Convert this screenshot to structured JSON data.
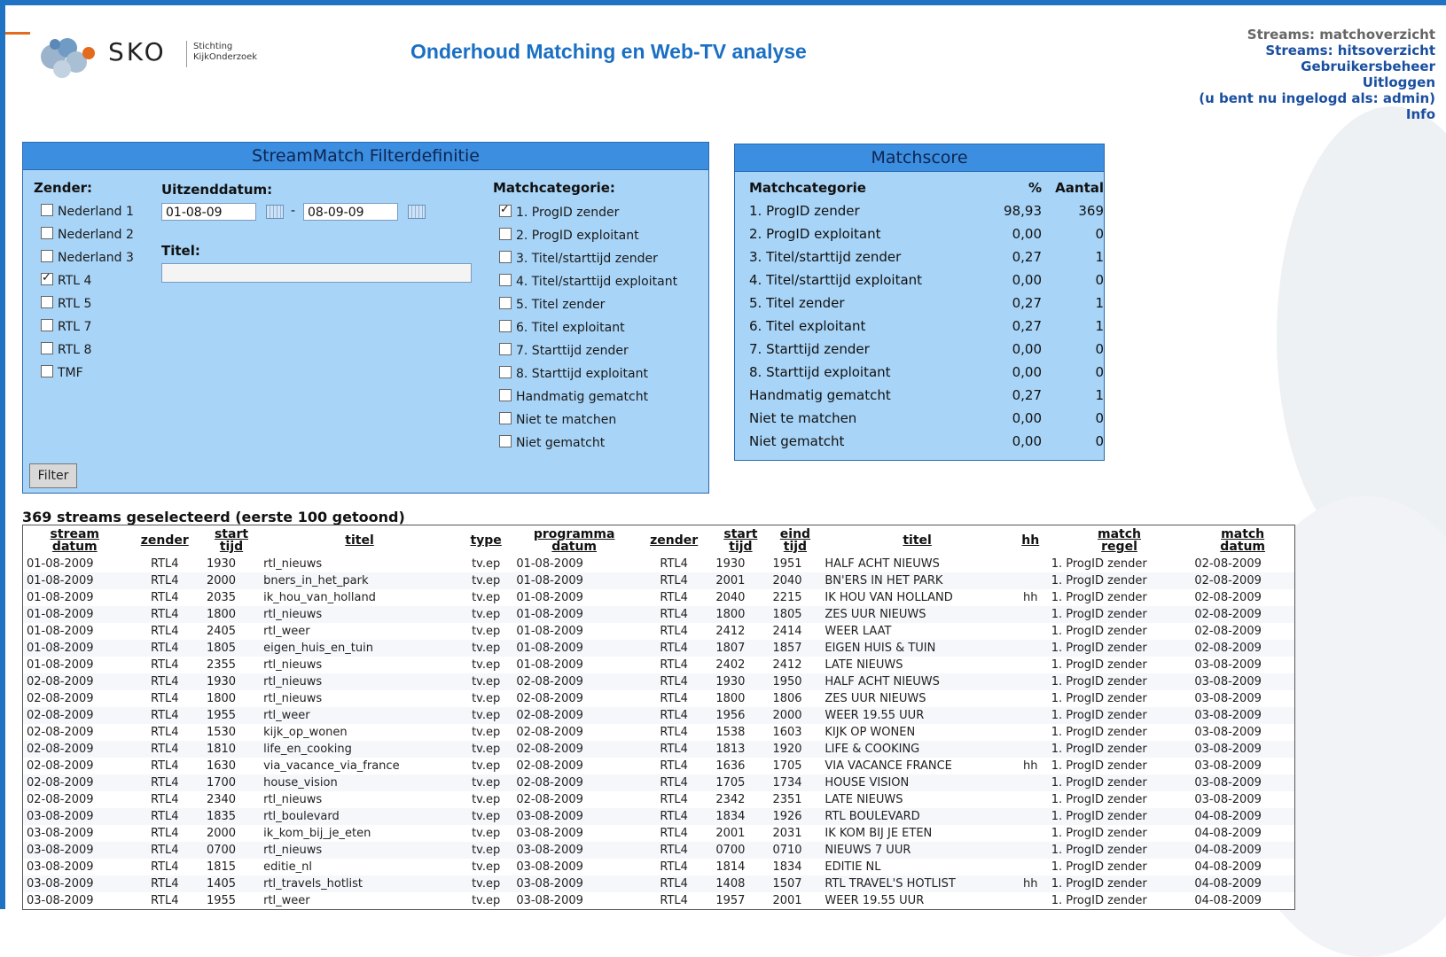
{
  "header": {
    "logo_text": "SKO",
    "logo_sub1": "Stichting",
    "logo_sub2": "KijkOnderzoek",
    "title": "Onderhoud Matching en Web-TV analyse"
  },
  "nav": {
    "matchoverzicht": "Streams: matchoverzicht",
    "hitsoverzicht": "Streams: hitsoverzicht",
    "gebruikersbeheer": "Gebruikersbeheer",
    "uitloggen": "Uitloggen",
    "ingelogd": "(u bent nu ingelogd als: admin)",
    "info": "Info"
  },
  "filter": {
    "title": "StreamMatch Filterdefinitie",
    "zender_label": "Zender:",
    "zenders": [
      {
        "label": "Nederland 1",
        "checked": false
      },
      {
        "label": "Nederland 2",
        "checked": false
      },
      {
        "label": "Nederland 3",
        "checked": false
      },
      {
        "label": "RTL 4",
        "checked": true
      },
      {
        "label": "RTL 5",
        "checked": false
      },
      {
        "label": "RTL 7",
        "checked": false
      },
      {
        "label": "RTL 8",
        "checked": false
      },
      {
        "label": "TMF",
        "checked": false
      }
    ],
    "uitzenddatum_label": "Uitzenddatum:",
    "date_from": "01-08-09",
    "date_sep": "-",
    "date_to": "08-09-09",
    "titel_label": "Titel:",
    "titel_value": "",
    "matchcat_label": "Matchcategorie:",
    "categories": [
      {
        "label": "1. ProgID zender",
        "checked": true
      },
      {
        "label": "2. ProgID exploitant",
        "checked": false
      },
      {
        "label": "3. Titel/starttijd zender",
        "checked": false
      },
      {
        "label": "4. Titel/starttijd exploitant",
        "checked": false
      },
      {
        "label": "5. Titel zender",
        "checked": false
      },
      {
        "label": "6. Titel exploitant",
        "checked": false
      },
      {
        "label": "7. Starttijd zender",
        "checked": false
      },
      {
        "label": "8. Starttijd exploitant",
        "checked": false
      },
      {
        "label": "Handmatig gematcht",
        "checked": false
      },
      {
        "label": "Niet te matchen",
        "checked": false
      },
      {
        "label": "Niet gematcht",
        "checked": false
      }
    ],
    "button": "Filter"
  },
  "score": {
    "title": "Matchscore",
    "headers": [
      "Matchcategorie",
      "%",
      "Aantal"
    ],
    "rows": [
      [
        "1. ProgID zender",
        "98,93",
        "369"
      ],
      [
        "2. ProgID exploitant",
        "0,00",
        "0"
      ],
      [
        "3. Titel/starttijd zender",
        "0,27",
        "1"
      ],
      [
        "4. Titel/starttijd exploitant",
        "0,00",
        "0"
      ],
      [
        "5. Titel zender",
        "0,27",
        "1"
      ],
      [
        "6. Titel exploitant",
        "0,27",
        "1"
      ],
      [
        "7. Starttijd zender",
        "0,00",
        "0"
      ],
      [
        "8. Starttijd exploitant",
        "0,00",
        "0"
      ],
      [
        "Handmatig gematcht",
        "0,27",
        "1"
      ],
      [
        "Niet te matchen",
        "0,00",
        "0"
      ],
      [
        "Niet gematcht",
        "0,00",
        "0"
      ]
    ]
  },
  "results": {
    "heading": "369 streams geselecteerd (eerste 100 getoond)",
    "headers": [
      [
        "stream",
        "datum"
      ],
      [
        "zender",
        ""
      ],
      [
        "start",
        "tijd"
      ],
      [
        "titel",
        ""
      ],
      [
        "type",
        ""
      ],
      [
        "programma",
        "datum"
      ],
      [
        "zender",
        ""
      ],
      [
        "start",
        "tijd"
      ],
      [
        "eind",
        "tijd"
      ],
      [
        "titel",
        ""
      ],
      [
        "hh",
        ""
      ],
      [
        "match",
        "regel"
      ],
      [
        "match",
        "datum"
      ]
    ],
    "rows": [
      [
        "01-08-2009",
        "RTL4",
        "1930",
        "rtl_nieuws",
        "tv.ep",
        "01-08-2009",
        "RTL4",
        "1930",
        "1951",
        "HALF ACHT NIEUWS",
        "",
        "1. ProgID zender",
        "02-08-2009"
      ],
      [
        "01-08-2009",
        "RTL4",
        "2000",
        "bners_in_het_park",
        "tv.ep",
        "01-08-2009",
        "RTL4",
        "2001",
        "2040",
        "BN'ERS IN HET PARK",
        "",
        "1. ProgID zender",
        "02-08-2009"
      ],
      [
        "01-08-2009",
        "RTL4",
        "2035",
        "ik_hou_van_holland",
        "tv.ep",
        "01-08-2009",
        "RTL4",
        "2040",
        "2215",
        "IK HOU VAN HOLLAND",
        "hh",
        "1. ProgID zender",
        "02-08-2009"
      ],
      [
        "01-08-2009",
        "RTL4",
        "1800",
        "rtl_nieuws",
        "tv.ep",
        "01-08-2009",
        "RTL4",
        "1800",
        "1805",
        "ZES UUR NIEUWS",
        "",
        "1. ProgID zender",
        "02-08-2009"
      ],
      [
        "01-08-2009",
        "RTL4",
        "2405",
        "rtl_weer",
        "tv.ep",
        "01-08-2009",
        "RTL4",
        "2412",
        "2414",
        "WEER LAAT",
        "",
        "1. ProgID zender",
        "02-08-2009"
      ],
      [
        "01-08-2009",
        "RTL4",
        "1805",
        "eigen_huis_en_tuin",
        "tv.ep",
        "01-08-2009",
        "RTL4",
        "1807",
        "1857",
        "EIGEN HUIS & TUIN",
        "",
        "1. ProgID zender",
        "02-08-2009"
      ],
      [
        "01-08-2009",
        "RTL4",
        "2355",
        "rtl_nieuws",
        "tv.ep",
        "01-08-2009",
        "RTL4",
        "2402",
        "2412",
        "LATE NIEUWS",
        "",
        "1. ProgID zender",
        "03-08-2009"
      ],
      [
        "02-08-2009",
        "RTL4",
        "1930",
        "rtl_nieuws",
        "tv.ep",
        "02-08-2009",
        "RTL4",
        "1930",
        "1950",
        "HALF ACHT NIEUWS",
        "",
        "1. ProgID zender",
        "03-08-2009"
      ],
      [
        "02-08-2009",
        "RTL4",
        "1800",
        "rtl_nieuws",
        "tv.ep",
        "02-08-2009",
        "RTL4",
        "1800",
        "1806",
        "ZES UUR NIEUWS",
        "",
        "1. ProgID zender",
        "03-08-2009"
      ],
      [
        "02-08-2009",
        "RTL4",
        "1955",
        "rtl_weer",
        "tv.ep",
        "02-08-2009",
        "RTL4",
        "1956",
        "2000",
        "WEER 19.55 UUR",
        "",
        "1. ProgID zender",
        "03-08-2009"
      ],
      [
        "02-08-2009",
        "RTL4",
        "1530",
        "kijk_op_wonen",
        "tv.ep",
        "02-08-2009",
        "RTL4",
        "1538",
        "1603",
        "KIJK OP WONEN",
        "",
        "1. ProgID zender",
        "03-08-2009"
      ],
      [
        "02-08-2009",
        "RTL4",
        "1810",
        "life_en_cooking",
        "tv.ep",
        "02-08-2009",
        "RTL4",
        "1813",
        "1920",
        "LIFE & COOKING",
        "",
        "1. ProgID zender",
        "03-08-2009"
      ],
      [
        "02-08-2009",
        "RTL4",
        "1630",
        "via_vacance_via_france",
        "tv.ep",
        "02-08-2009",
        "RTL4",
        "1636",
        "1705",
        "VIA VACANCE FRANCE",
        "hh",
        "1. ProgID zender",
        "03-08-2009"
      ],
      [
        "02-08-2009",
        "RTL4",
        "1700",
        "house_vision",
        "tv.ep",
        "02-08-2009",
        "RTL4",
        "1705",
        "1734",
        "HOUSE VISION",
        "",
        "1. ProgID zender",
        "03-08-2009"
      ],
      [
        "02-08-2009",
        "RTL4",
        "2340",
        "rtl_nieuws",
        "tv.ep",
        "02-08-2009",
        "RTL4",
        "2342",
        "2351",
        "LATE NIEUWS",
        "",
        "1. ProgID zender",
        "03-08-2009"
      ],
      [
        "03-08-2009",
        "RTL4",
        "1835",
        "rtl_boulevard",
        "tv.ep",
        "03-08-2009",
        "RTL4",
        "1834",
        "1926",
        "RTL BOULEVARD",
        "",
        "1. ProgID zender",
        "04-08-2009"
      ],
      [
        "03-08-2009",
        "RTL4",
        "2000",
        "ik_kom_bij_je_eten",
        "tv.ep",
        "03-08-2009",
        "RTL4",
        "2001",
        "2031",
        "IK KOM BIJ JE ETEN",
        "",
        "1. ProgID zender",
        "04-08-2009"
      ],
      [
        "03-08-2009",
        "RTL4",
        "0700",
        "rtl_nieuws",
        "tv.ep",
        "03-08-2009",
        "RTL4",
        "0700",
        "0710",
        "NIEUWS 7 UUR",
        "",
        "1. ProgID zender",
        "04-08-2009"
      ],
      [
        "03-08-2009",
        "RTL4",
        "1815",
        "editie_nl",
        "tv.ep",
        "03-08-2009",
        "RTL4",
        "1814",
        "1834",
        "EDITIE NL",
        "",
        "1. ProgID zender",
        "04-08-2009"
      ],
      [
        "03-08-2009",
        "RTL4",
        "1405",
        "rtl_travels_hotlist",
        "tv.ep",
        "03-08-2009",
        "RTL4",
        "1408",
        "1507",
        "RTL TRAVEL'S HOTLIST",
        "hh",
        "1. ProgID zender",
        "04-08-2009"
      ],
      [
        "03-08-2009",
        "RTL4",
        "1955",
        "rtl_weer",
        "tv.ep",
        "03-08-2009",
        "RTL4",
        "1957",
        "2001",
        "WEER 19.55 UUR",
        "",
        "1. ProgID zender",
        "04-08-2009"
      ]
    ]
  }
}
